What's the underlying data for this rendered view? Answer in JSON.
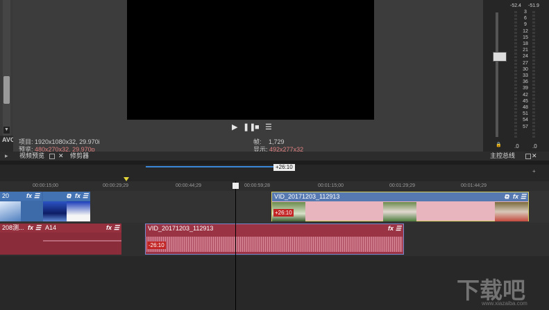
{
  "preview": {
    "project_label": "项目:",
    "project_value": "1920x1080x32, 29.970i",
    "preview_label": "预览:",
    "preview_value": "480x270x32, 29.970p",
    "frame_label": "帧:",
    "frame_value": "1,729",
    "display_label": "显示:",
    "display_value": "492x277x32"
  },
  "side_label": "AVC",
  "tabs": {
    "video_preview": "视频预览",
    "trimmer": "修剪器",
    "master_bus": "主控总线"
  },
  "meter": {
    "peak_left": "-52.4",
    "peak_right": "-51.9",
    "scale": [
      "3",
      "6",
      "9",
      "12",
      "15",
      "18",
      "21",
      "24",
      "27",
      "30",
      "33",
      "36",
      "39",
      "42",
      "45",
      "48",
      "51",
      "54",
      "57"
    ],
    "foot_left": ".0",
    "foot_right": ".0"
  },
  "timeline": {
    "selection_length": "+26:10",
    "ruler_ticks": [
      "00:00:15;00",
      "00:00:29;29",
      "00:00:44;29",
      "00:00:59;28",
      "00:01:15;00",
      "00:01:29;29",
      "00:01:44;29"
    ],
    "video_track": {
      "clip_left_label": "20",
      "clip_right_label": "VID_20171203_112913",
      "clip_right_badge": "+26:10"
    },
    "audio_track": {
      "clip1_label": "208测...",
      "clip2_label": "A14",
      "clip3_label": "VID_20171203_112913",
      "clip3_badge": "-26:10"
    }
  },
  "watermark": {
    "text": "下载吧",
    "url": "www.xiazaiba.com"
  },
  "icons": {
    "play": "play-icon",
    "pause": "pause-icon",
    "stop": "stop-icon",
    "menu": "menu-icon"
  }
}
